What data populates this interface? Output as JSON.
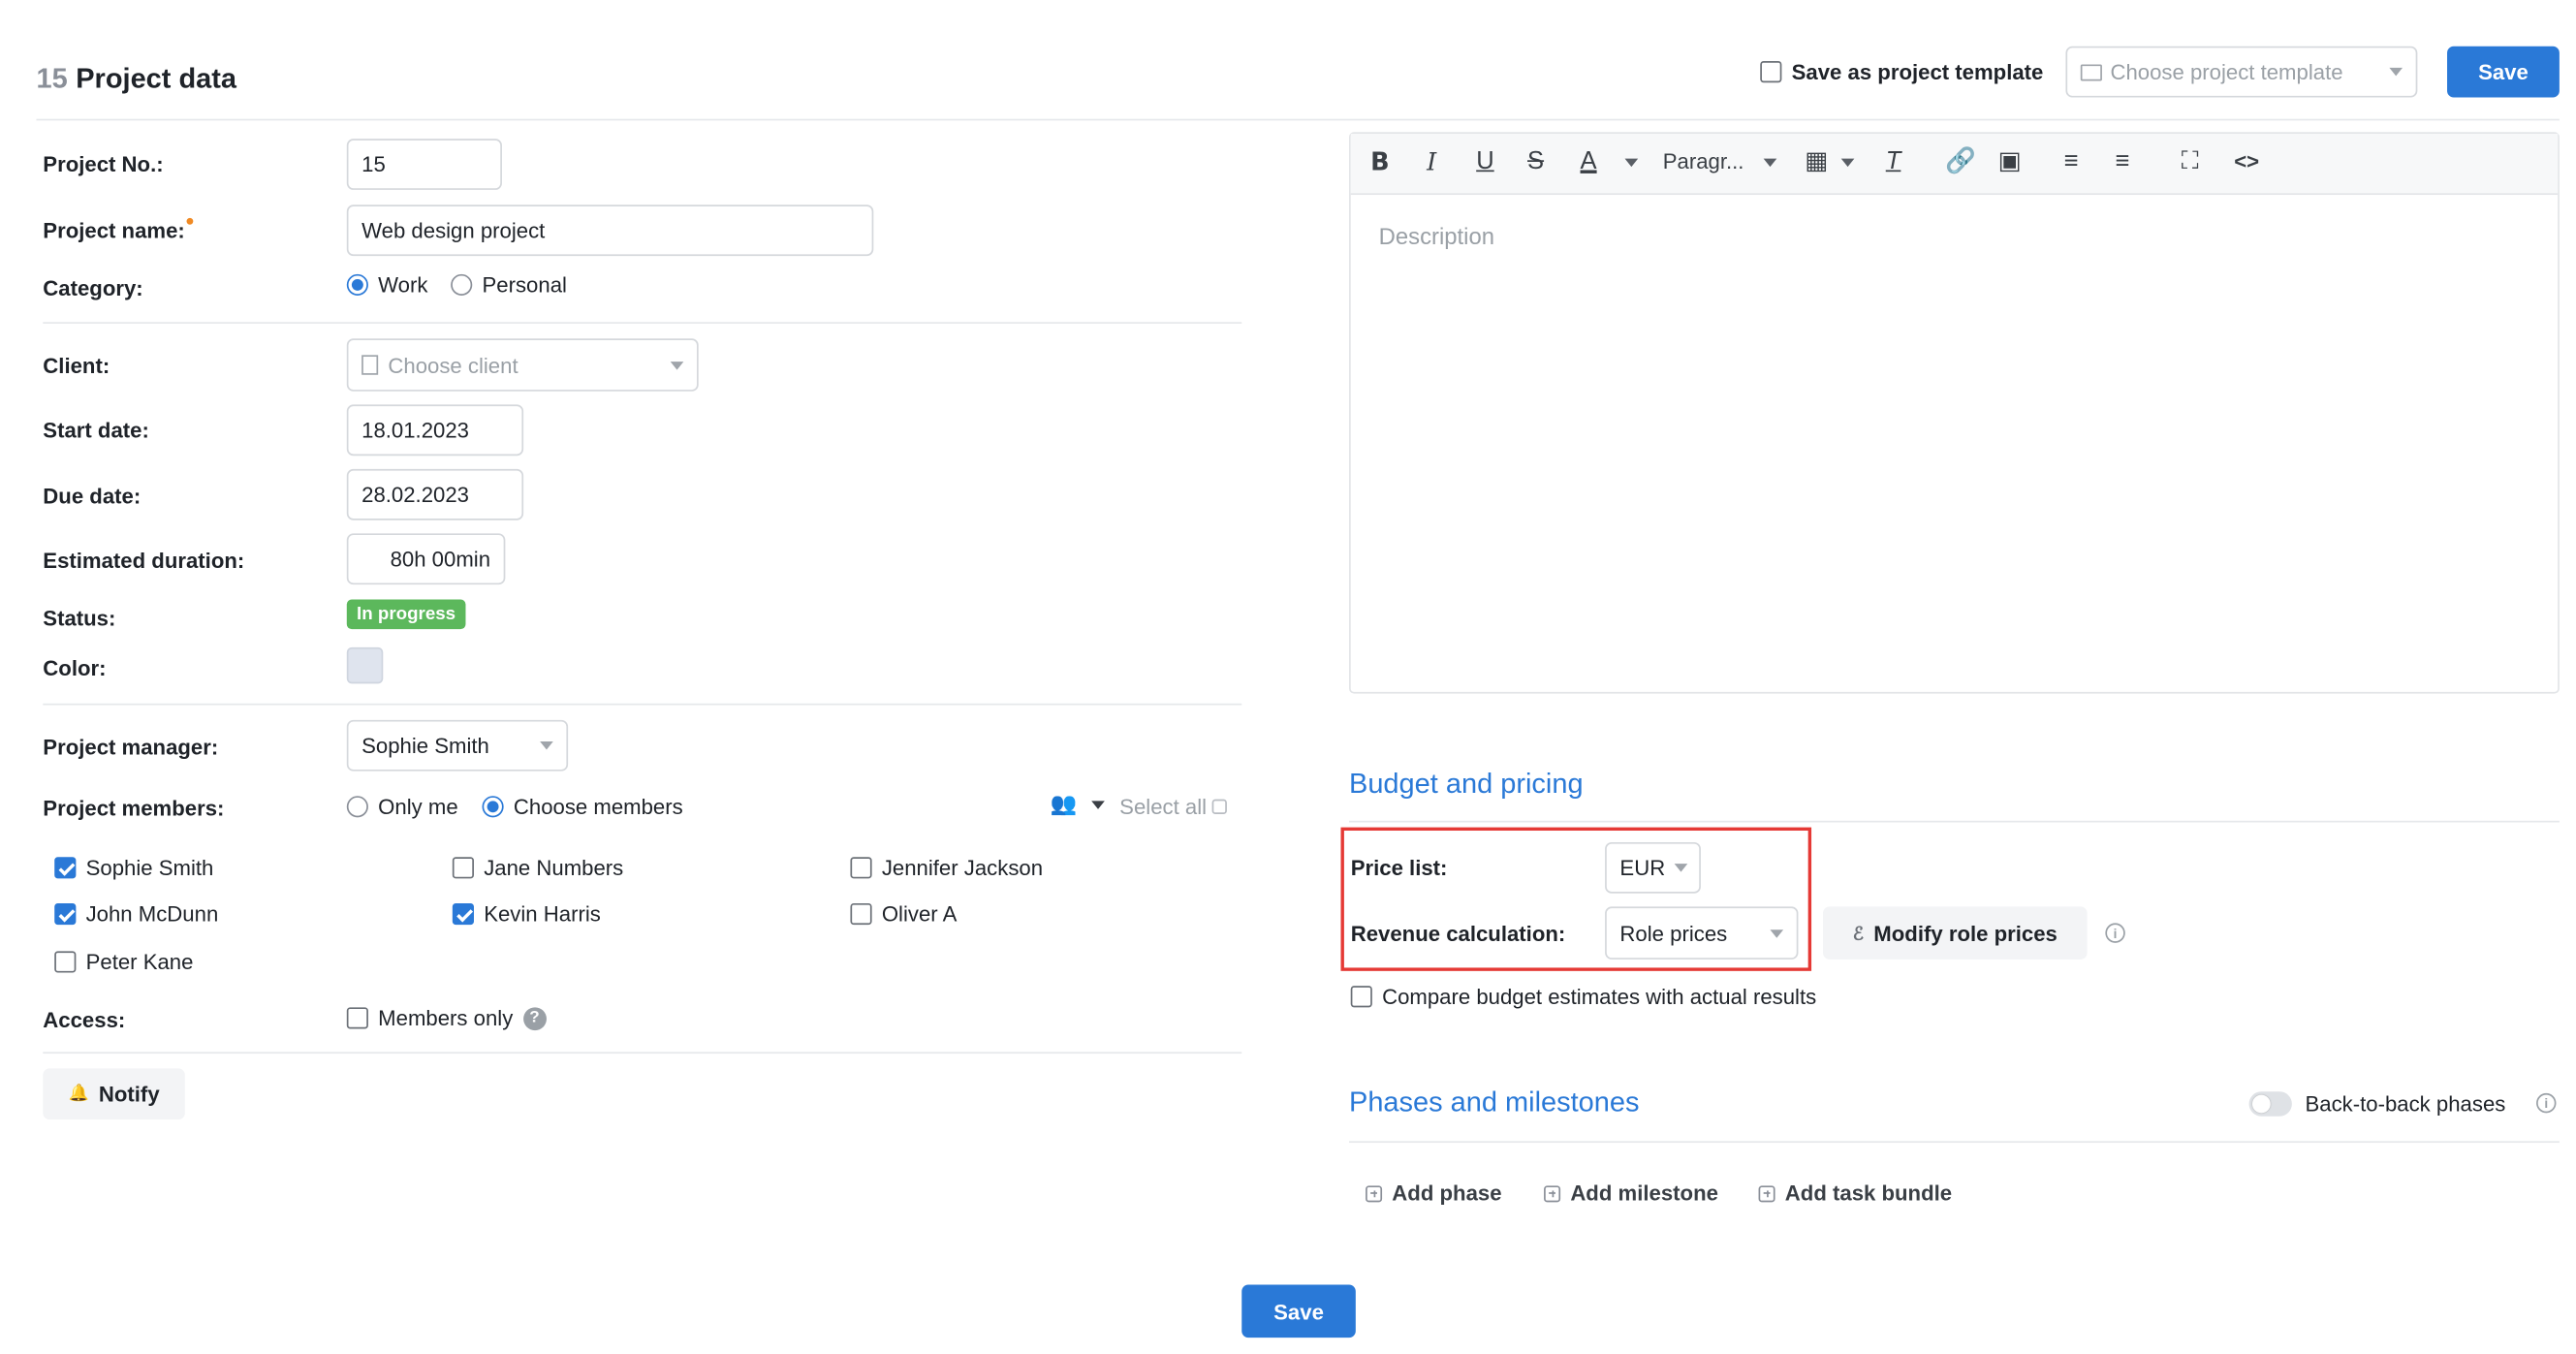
{
  "header": {
    "project_number": "15",
    "title": "Project data",
    "save_template_label": "Save as project template",
    "choose_template_placeholder": "Choose project template",
    "save_label": "Save"
  },
  "form": {
    "project_no_label": "Project No.:",
    "project_no_value": "15",
    "project_name_label": "Project name:",
    "project_name_value": "Web design project",
    "category_label": "Category:",
    "category_options": [
      "Work",
      "Personal"
    ],
    "category_selected": "Work",
    "client_label": "Client:",
    "client_placeholder": "Choose client",
    "start_date_label": "Start date:",
    "start_date_value": "18.01.2023",
    "due_date_label": "Due date:",
    "due_date_value": "28.02.2023",
    "estimated_duration_label": "Estimated duration:",
    "estimated_duration_value": "80h 00min",
    "status_label": "Status:",
    "status_value": "In progress",
    "color_label": "Color:",
    "color_value": "#dfe4ee",
    "project_manager_label": "Project manager:",
    "project_manager_value": "Sophie Smith",
    "project_members_label": "Project members:",
    "members_mode_options": [
      "Only me",
      "Choose members"
    ],
    "members_mode_selected": "Choose members",
    "select_all_label": "Select all",
    "members": [
      {
        "name": "Sophie Smith",
        "checked": true
      },
      {
        "name": "Jane Numbers",
        "checked": false
      },
      {
        "name": "Jennifer Jackson",
        "checked": false
      },
      {
        "name": "John McDunn",
        "checked": true
      },
      {
        "name": "Kevin Harris",
        "checked": true
      },
      {
        "name": "Oliver A",
        "checked": false
      },
      {
        "name": "Peter Kane",
        "checked": false
      }
    ],
    "access_label": "Access:",
    "members_only_label": "Members only",
    "notify_label": "Notify"
  },
  "editor": {
    "placeholder": "Description",
    "paragraph_label": "Paragr...",
    "tools": [
      "bold-icon",
      "italic-icon",
      "underline-icon",
      "strikethrough-icon",
      "font-color-icon",
      "table-icon",
      "clear-format-icon",
      "link-icon",
      "image-icon",
      "bullet-list-icon",
      "numbered-list-icon",
      "fullscreen-icon",
      "code-icon"
    ]
  },
  "budget": {
    "section_title": "Budget and pricing",
    "price_list_label": "Price list:",
    "price_list_value": "EUR",
    "revenue_calc_label": "Revenue calculation:",
    "revenue_calc_value": "Role prices",
    "modify_role_prices_label": "Modify role prices",
    "compare_label": "Compare budget estimates with actual results"
  },
  "phases": {
    "section_title": "Phases and milestones",
    "back_to_back_label": "Back-to-back phases",
    "add_phase_label": "Add phase",
    "add_milestone_label": "Add milestone",
    "add_task_bundle_label": "Add task bundle"
  },
  "footer": {
    "save_label": "Save"
  },
  "colors": {
    "accent": "#2a79d7",
    "status_in_progress": "#5cb85c",
    "highlight_box": "#e53935"
  }
}
